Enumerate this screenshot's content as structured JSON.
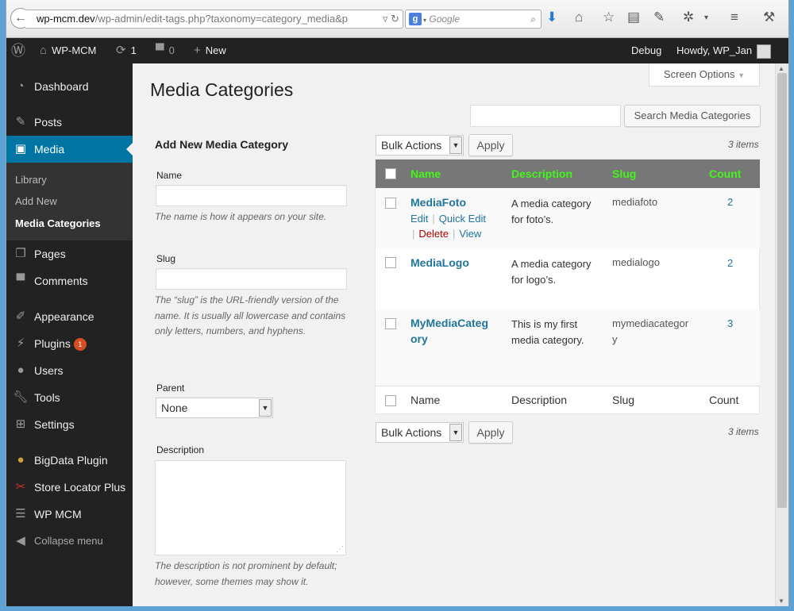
{
  "browser": {
    "back": "←",
    "url_domain": "wp-mcm.dev",
    "url_path": "/wp-admin/edit-tags.php?taxonomy=category_media&p",
    "search_placeholder": "Google"
  },
  "adminbar": {
    "site_name": "WP-MCM",
    "updates_count": "1",
    "comments_count": "0",
    "new_label": "New",
    "debug_label": "Debug",
    "howdy": "Howdy, WP_Jan"
  },
  "sidebar": {
    "dashboard": "Dashboard",
    "posts": "Posts",
    "media": "Media",
    "library": "Library",
    "add_new": "Add New",
    "media_categories": "Media Categories",
    "pages": "Pages",
    "comments": "Comments",
    "appearance": "Appearance",
    "plugins": "Plugins",
    "plugins_badge": "1",
    "users": "Users",
    "tools": "Tools",
    "settings": "Settings",
    "bigdata": "BigData Plugin",
    "store_locator": "Store Locator Plus",
    "wp_mcm": "WP MCM",
    "collapse": "Collapse menu"
  },
  "page": {
    "title": "Media Categories",
    "screen_options": "Screen Options",
    "search_button": "Search Media Categories"
  },
  "form": {
    "title": "Add New Media Category",
    "name_label": "Name",
    "name_help": "The name is how it appears on your site.",
    "slug_label": "Slug",
    "slug_help": "The “slug” is the URL-friendly version of the name. It is usually all lowercase and contains only letters, numbers, and hyphens.",
    "parent_label": "Parent",
    "parent_value": "None",
    "description_label": "Description",
    "description_help": "The description is not prominent by default; however, some themes may show it."
  },
  "table": {
    "bulk_actions": "Bulk Actions",
    "apply": "Apply",
    "items_count": "3 items",
    "headers": {
      "name": "Name",
      "description": "Description",
      "slug": "Slug",
      "count": "Count"
    },
    "header_color": "#43f61a",
    "rows": [
      {
        "name": "MediaFoto",
        "description": "A media category for foto’s.",
        "slug": "mediafoto",
        "count": "2"
      },
      {
        "name": "MediaLogo",
        "description": "A media category for logo’s.",
        "slug": "medialogo",
        "count": "2"
      },
      {
        "name": "MyMediaCategory",
        "description": "This is my first media category.",
        "slug": "mymediacategory",
        "count": "3"
      }
    ],
    "row_actions": {
      "edit": "Edit",
      "quick_edit": "Quick Edit",
      "delete": "Delete",
      "view": "View"
    }
  }
}
